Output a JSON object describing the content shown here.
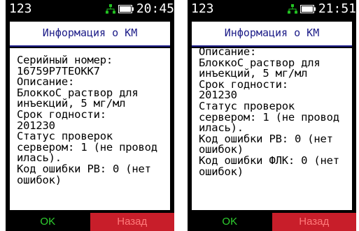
{
  "screens": [
    {
      "status": {
        "signal_label": "123",
        "time": "20:45"
      },
      "title": "Информация о КМ",
      "lines": [
        "Серийный номер:",
        "16759P7TEOKK7",
        "Описание:",
        "БлоккоС раствор для",
        "инъекций, 5 мг/мл",
        "Срок годности:",
        "201230",
        "Статус проверок",
        "сервером: 1 (не провод",
        "илась).",
        "Код ошибки РВ: 0 (нет",
        "ошибок)"
      ],
      "softkeys": {
        "ok": "OK",
        "back": "Назад"
      }
    },
    {
      "status": {
        "signal_label": "123",
        "time": "21:51"
      },
      "title": "Информация о КМ",
      "lines": [
        "Описание:",
        "БлоккоС раствор для",
        "инъекций, 5 мг/мл",
        "Срок годности:",
        "201230",
        "Статус проверок",
        "сервером: 1 (не провод",
        "илась).",
        "Код ошибки РВ: 0 (нет",
        "ошибок)",
        "Код ошибки ФЛК: 0 (нет",
        "ошибок)"
      ],
      "softkeys": {
        "ok": "OK",
        "back": "Назад"
      }
    }
  ],
  "icons": {
    "network": "network-icon",
    "battery": "battery-icon"
  },
  "colors": {
    "title_text": "#1c1c88",
    "ok_text": "#2fd12f",
    "back_bg": "#c81e2a",
    "network_icon": "#22c422"
  }
}
